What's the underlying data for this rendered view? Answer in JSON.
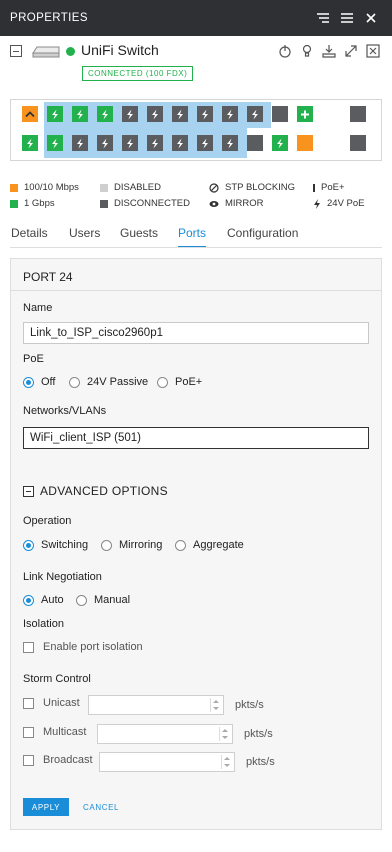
{
  "header": {
    "title": "PROPERTIES"
  },
  "device": {
    "name": "UniFi Switch",
    "status_badge": "CONNECTED (100 FDX)",
    "status_color": "#22b14c"
  },
  "legend": {
    "fast": "100/10 Mbps",
    "gig": "1 Gbps",
    "disabled": "DISABLED",
    "disconnected": "DISCONNECTED",
    "stp": "STP BLOCKING",
    "mirror": "MIRROR",
    "poe_plus": "PoE+",
    "poe24": "24V PoE"
  },
  "tabs": [
    "Details",
    "Users",
    "Guests",
    "Ports",
    "Configuration"
  ],
  "active_tab": "Ports",
  "form": {
    "port_title": "PORT 24",
    "name_label": "Name",
    "name_value": "Link_to_ISP_cisco2960p1",
    "poe_label": "PoE",
    "poe_options": [
      "Off",
      "24V Passive",
      "PoE+"
    ],
    "poe_selected": "Off",
    "networks_label": "Networks/VLANs",
    "network_value": "WiFi_client_ISP (501)",
    "advanced_label": "ADVANCED OPTIONS",
    "operation_label": "Operation",
    "operation_options": [
      "Switching",
      "Mirroring",
      "Aggregate"
    ],
    "operation_selected": "Switching",
    "link_label": "Link Negotiation",
    "link_options": [
      "Auto",
      "Manual"
    ],
    "link_selected": "Auto",
    "isolation_label": "Isolation",
    "isolation_checkbox": "Enable port isolation",
    "storm_label": "Storm Control",
    "storm_rows": [
      {
        "label": "Unicast",
        "unit": "pkts/s"
      },
      {
        "label": "Multicast",
        "unit": "pkts/s"
      },
      {
        "label": "Broadcast",
        "unit": "pkts/s"
      }
    ],
    "apply": "APPLY",
    "cancel": "CANCEL"
  },
  "colors": {
    "accent": "#1a8dd8",
    "green": "#22b14c",
    "orange": "#f7931e",
    "disconnected": "#5a5c60",
    "header_bg": "#2f3033"
  }
}
